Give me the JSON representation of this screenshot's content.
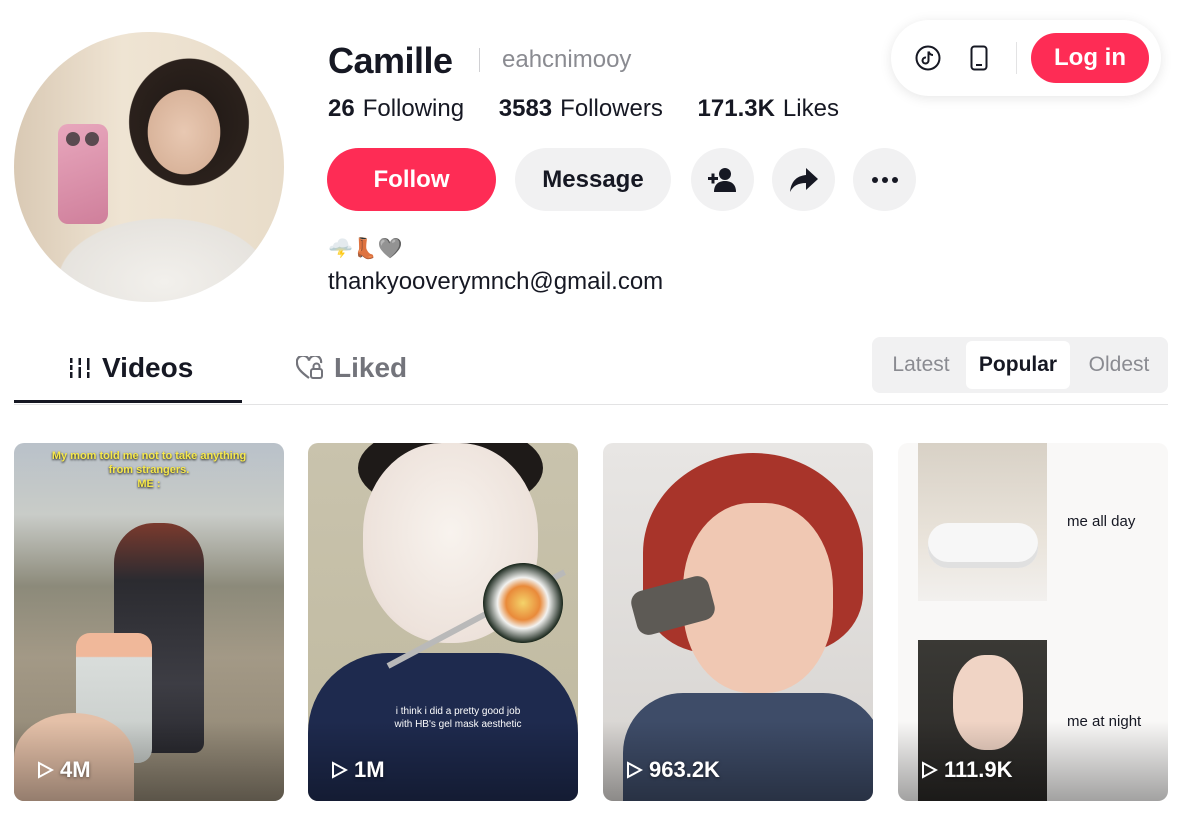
{
  "profile": {
    "name": "Camille",
    "handle": "eahcnimooy",
    "stats": [
      {
        "value": "26",
        "label": "Following"
      },
      {
        "value": "3583",
        "label": "Followers"
      },
      {
        "value": "171.3K",
        "label": "Likes"
      }
    ],
    "bio_emoji": "🌩️👢🩶",
    "bio_email": "thankyooverymnch@gmail.com"
  },
  "actions": {
    "follow_label": "Follow",
    "message_label": "Message"
  },
  "topbar": {
    "login_label": "Log in"
  },
  "tabs": [
    {
      "label": "Videos",
      "active": true
    },
    {
      "label": "Liked",
      "active": false
    }
  ],
  "sort": {
    "options": [
      "Latest",
      "Popular",
      "Oldest"
    ],
    "selected": "Popular"
  },
  "videos": [
    {
      "views": "4M",
      "caption_lines": [
        "My mom told me not to take anything",
        "from strangers.",
        "ME :"
      ]
    },
    {
      "views": "1M",
      "caption_lines": [
        "i think i did a pretty good job",
        "with HB's gel mask aesthetic"
      ]
    },
    {
      "views": "963.2K"
    },
    {
      "views": "111.9K",
      "texts": [
        "me all day",
        "me at night"
      ]
    }
  ],
  "colors": {
    "accent": "#fe2c55",
    "text": "#161823",
    "muted": "#8a8b91",
    "button_bg": "#f1f1f2"
  }
}
